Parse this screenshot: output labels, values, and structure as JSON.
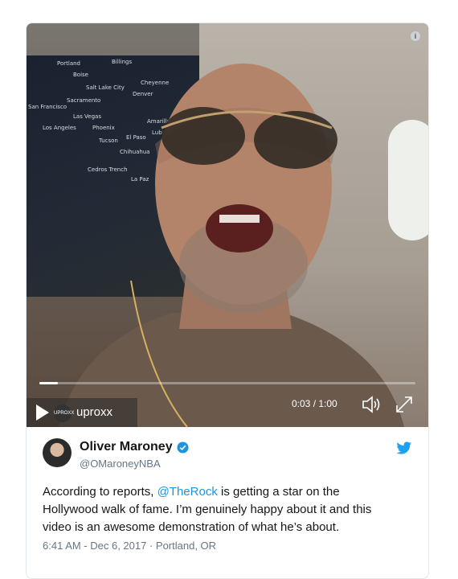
{
  "video": {
    "time_display": "0:03 / 1:00",
    "progress_fraction": 0.05,
    "brand_name": "uproxx",
    "brand_badge": "UPROXX",
    "map_labels": [
      "Portland",
      "Billings",
      "Boise",
      "Salt Lake City",
      "Cheyenne",
      "Denver",
      "Sacramento",
      "San Francisco",
      "Las Vegas",
      "Amarillo",
      "Los Angeles",
      "Phoenix",
      "Tucson",
      "El Paso",
      "Lubbock",
      "Chihuahua",
      "Cedros Trench",
      "La Paz"
    ]
  },
  "tweet": {
    "author_name": "Oliver Maroney",
    "author_handle": "@OMaroneyNBA",
    "text_before": "According to reports, ",
    "mention": "@TheRock",
    "text_after": " is getting a star on the Hollywood walk of fame. I’m genuinely happy about it and this video is an awesome demonstration of what he’s about.",
    "meta": "6:41 AM - Dec 6, 2017 · Portland, OR"
  },
  "colors": {
    "accent": "#1b95e0",
    "text": "#14171a",
    "secondary": "#657786"
  }
}
